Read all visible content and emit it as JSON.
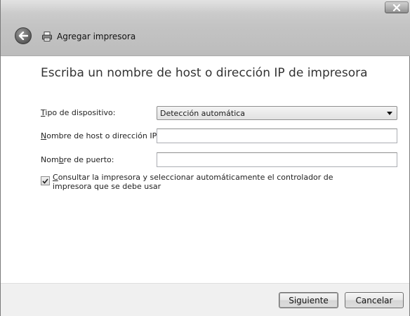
{
  "window": {
    "title": "Agregar impresora"
  },
  "heading": "Escriba un nombre de host o dirección IP de impresora",
  "form": {
    "device_type": {
      "label_key": "T",
      "label_rest": "ipo de dispositivo:",
      "value": "Detección automática"
    },
    "host": {
      "label_key": "N",
      "label_rest": "ombre de host o dirección IP:",
      "value": "",
      "placeholder": ""
    },
    "port": {
      "label_pre": "Nom",
      "label_key": "b",
      "label_rest": "re de puerto:",
      "value": "",
      "placeholder": ""
    },
    "auto_driver": {
      "label_key": "C",
      "label_rest": "onsultar la impresora y seleccionar automáticamente el controlador de impresora que se debe usar",
      "checked": true
    }
  },
  "buttons": {
    "next": "Siguiente",
    "cancel": "Cancelar"
  },
  "icons": {
    "close": "close-icon",
    "back": "back-arrow-icon",
    "printer": "printer-icon",
    "dropdown": "chevron-down-icon",
    "check": "checkmark-icon"
  }
}
